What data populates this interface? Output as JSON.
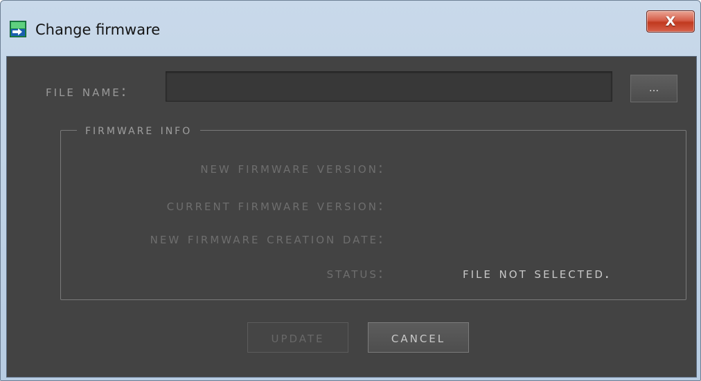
{
  "window": {
    "title": "Change firmware",
    "icon": "app-window-icon",
    "close_label": "X"
  },
  "file": {
    "label": "File name:",
    "value": "",
    "placeholder": "",
    "browse_label": "..."
  },
  "firmware_info": {
    "legend": "Firmware info",
    "new_version_label": "New firmware version:",
    "new_version_value": "",
    "current_version_label": "Current firmware version:",
    "current_version_value": "",
    "creation_date_label": "New firmware creation date:",
    "creation_date_value": "",
    "status_label": "Status:",
    "status_value": "File not selected."
  },
  "buttons": {
    "update_label": "Update",
    "update_enabled": false,
    "cancel_label": "Cancel"
  },
  "colors": {
    "dialog_background": "#434343",
    "title_bar": "#c3d5e9",
    "close_button": "#c9412a",
    "label_dim": "#6e6e6e",
    "status_text": "#c8c8c8"
  }
}
